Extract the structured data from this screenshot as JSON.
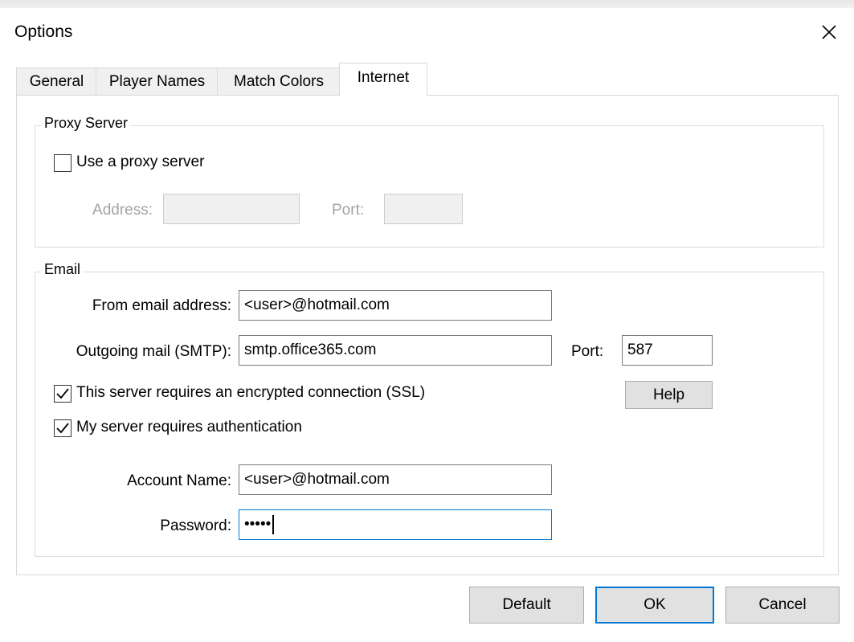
{
  "window": {
    "title": "Options"
  },
  "tabs": [
    {
      "label": "General"
    },
    {
      "label": "Player Names"
    },
    {
      "label": "Match Colors"
    },
    {
      "label": "Internet"
    }
  ],
  "active_tab": "Internet",
  "proxy": {
    "group_label": "Proxy Server",
    "use_proxy_label": "Use a proxy server",
    "use_proxy_checked": false,
    "address_label": "Address:",
    "address_value": "",
    "port_label": "Port:",
    "port_value": ""
  },
  "email": {
    "group_label": "Email",
    "from_label": "From email address:",
    "from_value": "<user>@hotmail.com",
    "smtp_label": "Outgoing mail (SMTP):",
    "smtp_value": "smtp.office365.com",
    "port_label": "Port:",
    "port_value": "587",
    "ssl_label": "This server requires an encrypted connection (SSL)",
    "ssl_checked": true,
    "help_label": "Help",
    "auth_label": "My server requires authentication",
    "auth_checked": true,
    "account_label": "Account Name:",
    "account_value": "<user>@hotmail.com",
    "password_label": "Password:",
    "password_value": "•••••"
  },
  "buttons": {
    "default_label": "Default",
    "ok_label": "OK",
    "cancel_label": "Cancel"
  },
  "colors": {
    "accent": "#0078d7",
    "window_bg": "#ffffff",
    "button_bg": "#e1e1e1",
    "disabled_text": "#a3a3a3"
  },
  "icons": {
    "close": "close-icon",
    "checkmark": "checkmark-icon"
  }
}
